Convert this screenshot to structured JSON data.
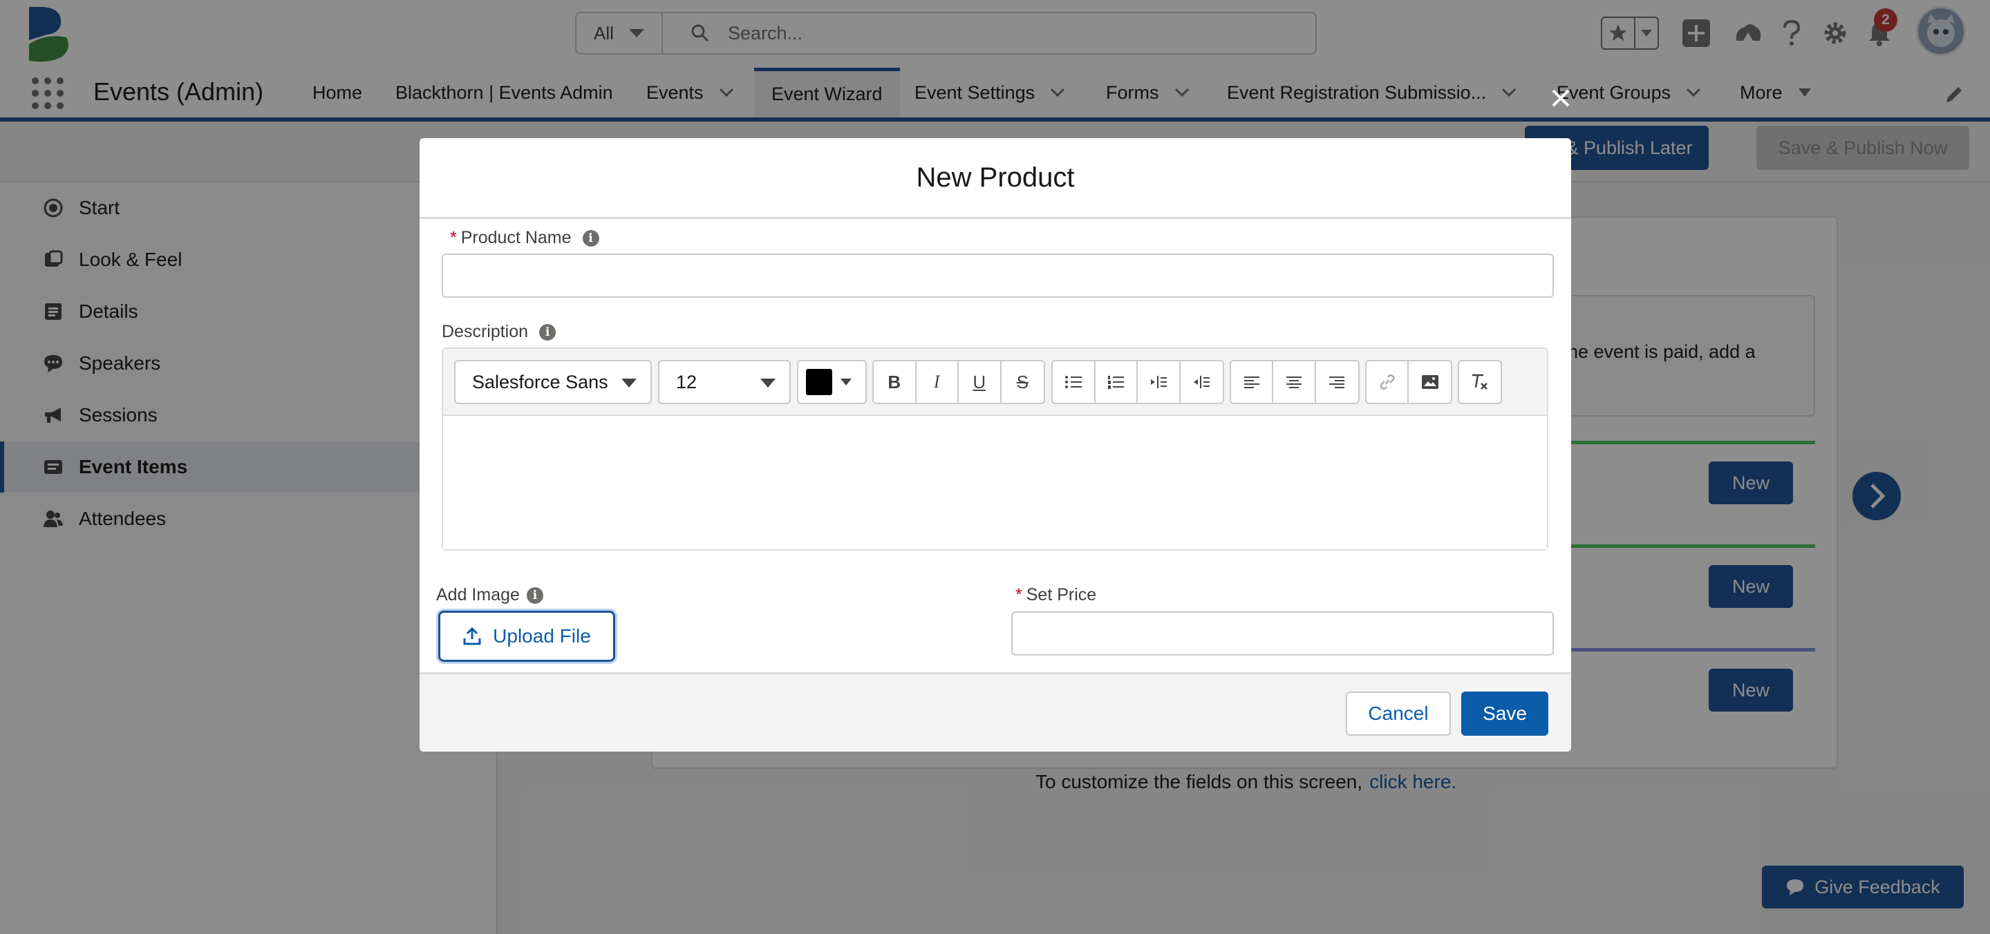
{
  "header": {
    "search_scope": "All",
    "search_placeholder": "Search...",
    "notification_count": "2"
  },
  "nav": {
    "app_name": "Events (Admin)",
    "items": [
      {
        "label": "Home"
      },
      {
        "label": "Blackthorn | Events Admin"
      },
      {
        "label": "Events"
      },
      {
        "label": "Event Wizard"
      },
      {
        "label": "Event Settings"
      },
      {
        "label": "Forms"
      },
      {
        "label": "Event Registration Submissio..."
      },
      {
        "label": "Event Groups"
      },
      {
        "label": "More"
      }
    ]
  },
  "toolbar": {
    "publish_later": "ve & Publish Later",
    "publish_now": "Save & Publish Now"
  },
  "sidebar": {
    "items": [
      {
        "label": "Start",
        "icon": "radio-icon"
      },
      {
        "label": "Look & Feel",
        "icon": "palette-icon"
      },
      {
        "label": "Details",
        "icon": "details-icon"
      },
      {
        "label": "Speakers",
        "icon": "speech-icon"
      },
      {
        "label": "Sessions",
        "icon": "megaphone-icon"
      },
      {
        "label": "Event Items",
        "icon": "ticket-icon"
      },
      {
        "label": "Attendees",
        "icon": "people-icon"
      }
    ]
  },
  "main": {
    "info_text_line1": "he event is paid, add a",
    "new_label": "New",
    "customize_text": "To customize the fields on this screen,",
    "customize_link": "click here.",
    "feedback": "Give Feedback",
    "section_colors": [
      "#45c65a",
      "#45c65a",
      "#7f8de1"
    ]
  },
  "modal": {
    "title": "New Product",
    "product_name_label": "Product Name",
    "product_name_value": "",
    "description_label": "Description",
    "font_family": "Salesforce Sans",
    "font_size": "12",
    "add_image_label": "Add Image",
    "upload_label": "Upload File",
    "set_price_label": "Set Price",
    "set_price_value": "",
    "cancel_label": "Cancel",
    "save_label": "Save"
  },
  "colors": {
    "brand": "#1b5297",
    "link": "#0b5cab",
    "required": "#ba0517"
  }
}
